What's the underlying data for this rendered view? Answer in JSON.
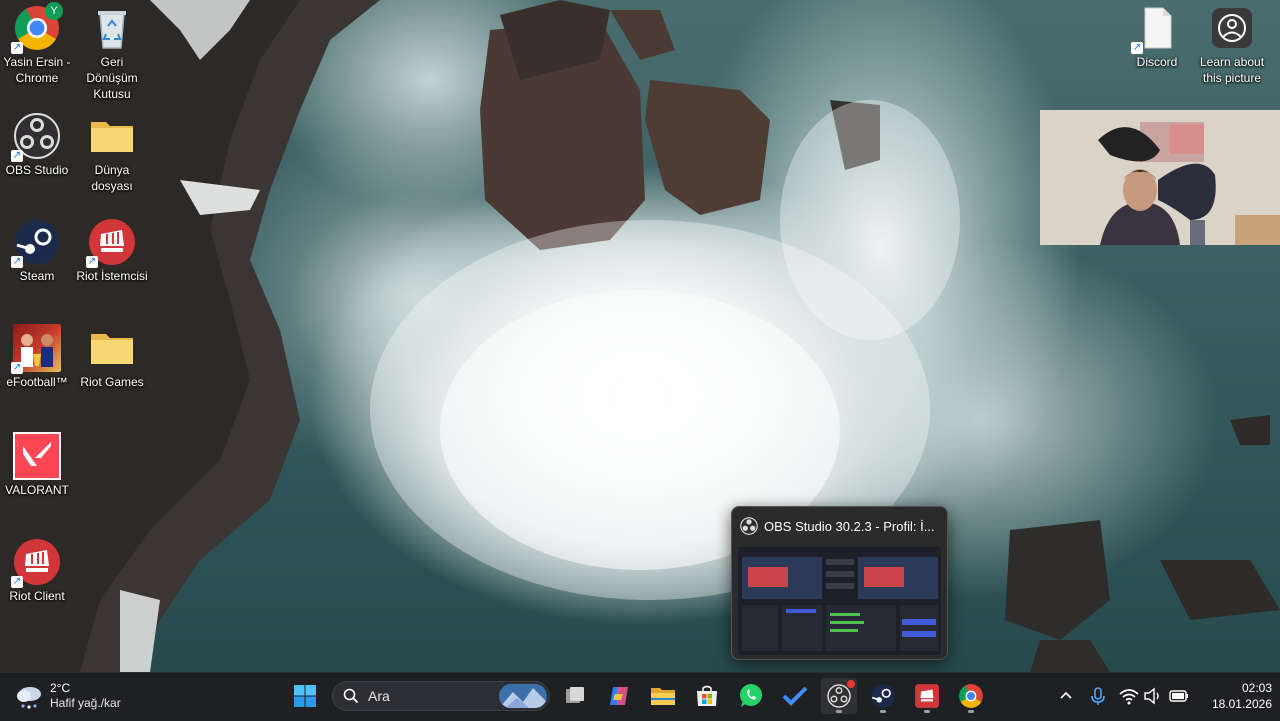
{
  "desktop": {
    "icons": [
      {
        "label": "Yasin Ersin - Chrome",
        "icon": "chrome-profile-icon"
      },
      {
        "label": "Geri Dönüşüm Kutusu",
        "icon": "recycle-bin-icon"
      },
      {
        "label": "OBS Studio",
        "icon": "obs-icon"
      },
      {
        "label": "Dünya dosyası",
        "icon": "folder-icon"
      },
      {
        "label": "Steam",
        "icon": "steam-icon"
      },
      {
        "label": "Riot İstemcisi",
        "icon": "riot-icon"
      },
      {
        "label": "eFootball™",
        "icon": "efootball-icon"
      },
      {
        "label": "Riot Games",
        "icon": "folder-icon"
      },
      {
        "label": "VALORANT",
        "icon": "valorant-icon"
      },
      {
        "label": "Riot Client",
        "icon": "riot-icon"
      },
      {
        "label": "Discord",
        "icon": "file-icon"
      },
      {
        "label": "Learn about this picture",
        "icon": "learn-picture-icon"
      }
    ],
    "profile_badge": "Y"
  },
  "obs_preview": {
    "title": "OBS Studio 30.2.3 - Profil: İ..."
  },
  "taskbar": {
    "weather": {
      "temp": "2°C",
      "condition": "Hafif yağ./kar",
      "icon": "weather-snow-icon"
    },
    "search_placeholder": "Ara",
    "apps": [
      {
        "name": "start",
        "icon": "windows-start-icon"
      },
      {
        "name": "task-view",
        "icon": "task-view-icon"
      },
      {
        "name": "copilot",
        "icon": "copilot-icon"
      },
      {
        "name": "file-explorer",
        "icon": "folder-icon"
      },
      {
        "name": "microsoft-store",
        "icon": "store-icon"
      },
      {
        "name": "whatsapp",
        "icon": "whatsapp-icon"
      },
      {
        "name": "todo",
        "icon": "checkmark-icon"
      },
      {
        "name": "obs-studio",
        "icon": "obs-icon"
      },
      {
        "name": "steam",
        "icon": "steam-icon"
      },
      {
        "name": "riot-client",
        "icon": "riot-icon"
      },
      {
        "name": "chrome",
        "icon": "chrome-icon"
      }
    ],
    "tray": {
      "time": "02:03",
      "date": "18.01.2026"
    }
  },
  "colors": {
    "taskbar_bg": "#1f2023",
    "accent_blue": "#0078d4",
    "riot_red": "#d13639",
    "valorant_red": "#ff4655"
  }
}
